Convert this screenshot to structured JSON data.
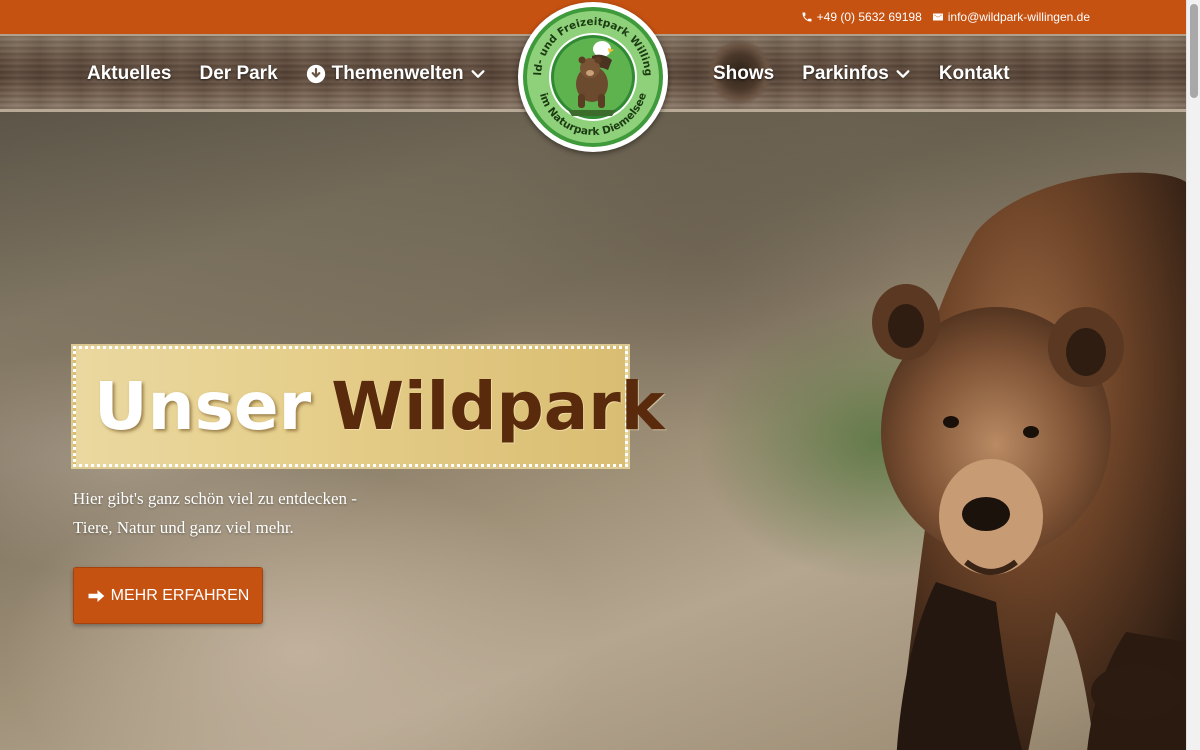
{
  "topbar": {
    "phone": "+49 (0) 5632 69198",
    "email": "info@wildpark-willingen.de",
    "phone_icon": "phone-icon",
    "email_icon": "envelope-icon"
  },
  "nav": {
    "left": [
      {
        "label": "Aktuelles"
      },
      {
        "label": "Der Park"
      },
      {
        "label": "Themenwelten",
        "icon": "arrow-circle-down-icon",
        "dropdown": true
      }
    ],
    "right": [
      {
        "label": "Shows"
      },
      {
        "label": "Parkinfos",
        "dropdown": true
      },
      {
        "label": "Kontakt"
      }
    ]
  },
  "logo": {
    "top_text": "Wild- und Freizeitpark Willingen",
    "bottom_text": "im Naturpark Diemelsee"
  },
  "hero": {
    "title_part1": "Unser",
    "title_part2": "Wildpark",
    "subtitle_line1": "Hier gibt's ganz schön viel zu entdecken -",
    "subtitle_line2": "Tiere, Natur und ganz viel mehr.",
    "cta_label": "MEHR ERFAHREN",
    "cta_icon": "arrow-right-icon"
  },
  "colors": {
    "accent": "#c65212",
    "title_dark": "#5a2a0c",
    "logo_green": "#3a9a3a"
  }
}
